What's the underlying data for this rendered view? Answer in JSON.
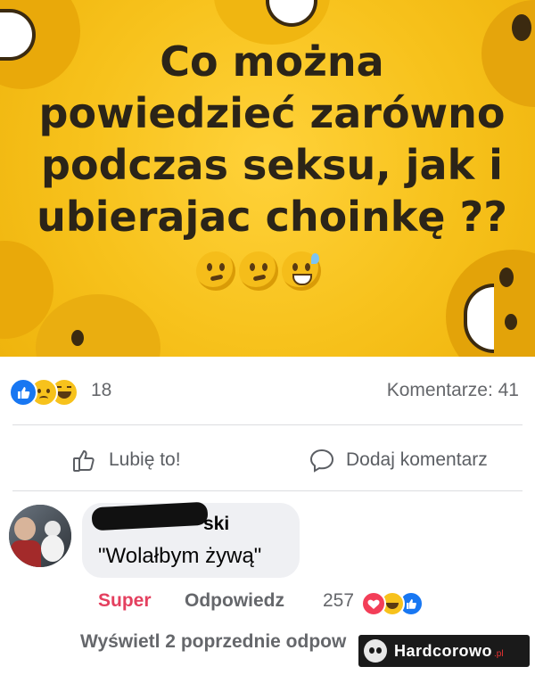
{
  "post": {
    "text_lines": [
      "Co można",
      "powiedzieć zarówno",
      "podczas seksu, jak i",
      "ubierajac choinkę ??"
    ],
    "emoji_names": [
      "thinking-face",
      "thinking-face",
      "grinning-sweat-face"
    ]
  },
  "reactions": {
    "count": "18",
    "types": [
      "like",
      "sad",
      "haha"
    ],
    "comments_label": "Komentarze: 41"
  },
  "actions": {
    "like_label": "Lubię to!",
    "comment_label": "Dodaj komentarz"
  },
  "comment": {
    "author_visible": "ski",
    "text": "\"Wolałbym żywą\"",
    "reaction_label": "Super",
    "reply_label": "Odpowiedz",
    "reaction_count": "257",
    "reaction_types": [
      "love",
      "haha",
      "like"
    ]
  },
  "view_previous": "Wyświetl 2 poprzednie odpow",
  "watermark": {
    "brand": "Hardcorowo",
    "tld": ".pl"
  },
  "colors": {
    "post_bg": "#f7c21c",
    "like_blue": "#1877f2",
    "love_red": "#f33e58",
    "super_pink": "#e4405f",
    "muted_text": "#65676b"
  }
}
